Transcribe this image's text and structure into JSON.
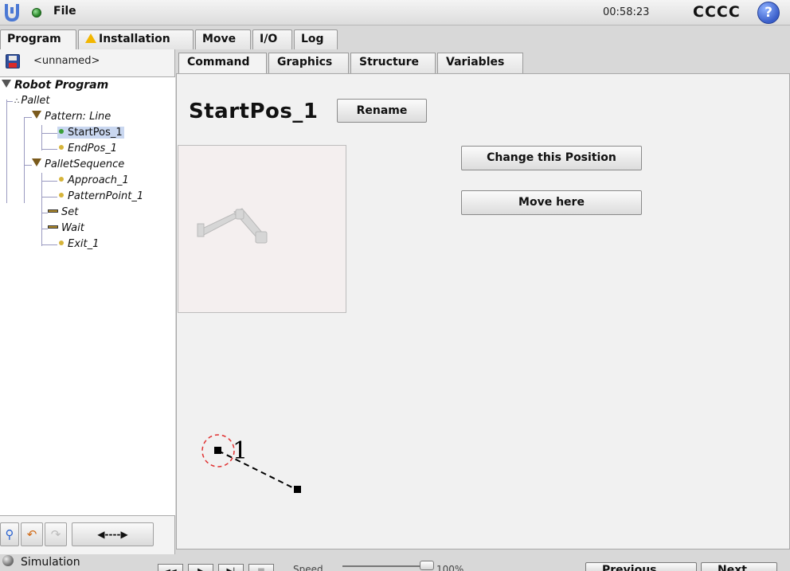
{
  "topbar": {
    "file_menu": "File",
    "clock": "00:58:23",
    "robot_name": "CCCC",
    "help": "?"
  },
  "main_tabs": [
    "Program",
    "Installation",
    "Move",
    "I/O",
    "Log"
  ],
  "program": {
    "file_name": "<unnamed>"
  },
  "tree": [
    {
      "label": "Robot Program"
    },
    {
      "label": "Pallet"
    },
    {
      "label": "Pattern: Line"
    },
    {
      "label": "StartPos_1"
    },
    {
      "label": "EndPos_1"
    },
    {
      "label": "PalletSequence"
    },
    {
      "label": "Approach_1"
    },
    {
      "label": "PatternPoint_1"
    },
    {
      "label": "Set"
    },
    {
      "label": "Wait"
    },
    {
      "label": "Exit_1"
    }
  ],
  "left_toolbar": {
    "arrow_label": "◀----▶"
  },
  "sub_tabs": [
    "Command",
    "Graphics",
    "Structure",
    "Variables"
  ],
  "command": {
    "position_name": "StartPos_1",
    "rename_label": "Rename",
    "change_position_label": "Change this Position",
    "move_here_label": "Move here",
    "pattern_point_label": "1"
  },
  "bottombar": {
    "simulation_label": "Simulation",
    "speed_label": "Speed",
    "speed_value": "100%",
    "speed_fraction": 1.0,
    "previous_label": "Previous",
    "next_label": "Next"
  }
}
